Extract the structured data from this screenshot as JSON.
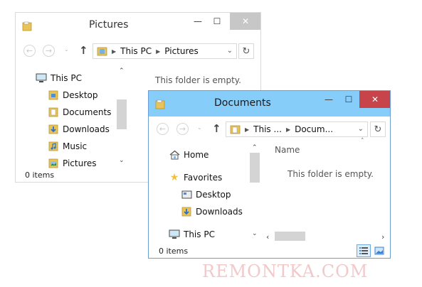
{
  "pictures_window": {
    "title": "Pictures",
    "address": {
      "crumbs": [
        "This PC",
        "Pictures"
      ]
    },
    "tree": [
      {
        "label": "This PC",
        "icon": "computer-icon"
      },
      {
        "label": "Desktop",
        "icon": "folder-desktop-icon"
      },
      {
        "label": "Documents",
        "icon": "folder-documents-icon"
      },
      {
        "label": "Downloads",
        "icon": "folder-downloads-icon"
      },
      {
        "label": "Music",
        "icon": "folder-music-icon"
      },
      {
        "label": "Pictures",
        "icon": "folder-pictures-icon"
      }
    ],
    "empty_message": "This folder is empty.",
    "status": "0 items"
  },
  "documents_window": {
    "title": "Documents",
    "address": {
      "crumbs": [
        "This ...",
        "Docum..."
      ]
    },
    "tree": [
      {
        "label": "Home",
        "icon": "home-icon"
      },
      {
        "label": "Favorites",
        "icon": "star-icon"
      },
      {
        "label": "Desktop",
        "icon": "desktop-icon"
      },
      {
        "label": "Downloads",
        "icon": "folder-downloads-icon"
      },
      {
        "label": "This PC",
        "icon": "computer-icon"
      }
    ],
    "column_name": "Name",
    "empty_message": "This folder is empty.",
    "status": "0 items"
  },
  "caption_glyphs": {
    "minimize": "—",
    "maximize": "☐",
    "close": "✕"
  },
  "nav_glyphs": {
    "back": "←",
    "forward": "→",
    "up": "↑",
    "refresh": "↻",
    "dropdown": "⌄"
  },
  "watermark": "REMONTKA.COM",
  "colors": {
    "active_title": "#87cdf9",
    "close_active": "#c8444b",
    "folder": "#e8c458",
    "accent": "#3b7fd1"
  }
}
